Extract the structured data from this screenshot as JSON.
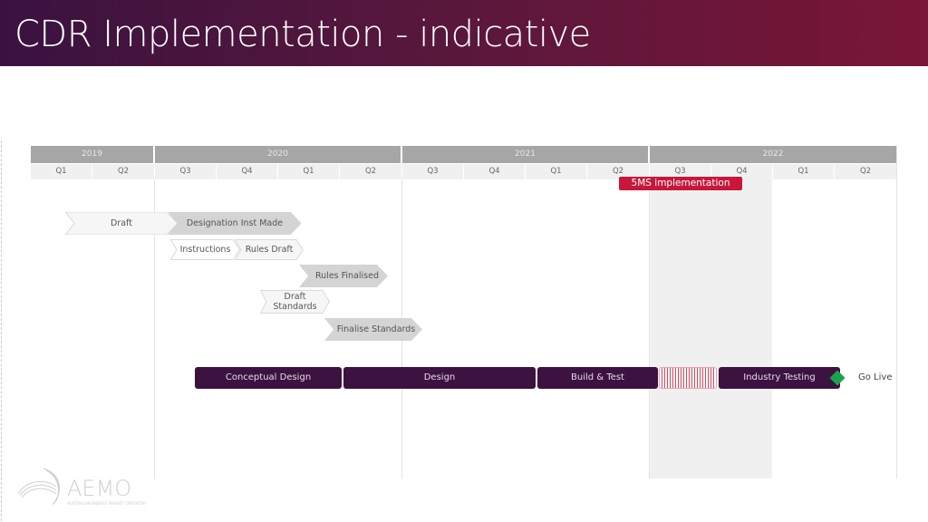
{
  "title": "CDR Implementation - indicative",
  "timeline": {
    "years": [
      "2019",
      "2020",
      "2021",
      "2022"
    ],
    "quarters": [
      "Q1",
      "Q2",
      "Q3",
      "Q4",
      "Q1",
      "Q2",
      "Q3",
      "Q4",
      "Q1",
      "Q2",
      "Q3",
      "Q4",
      "Q1",
      "Q2"
    ]
  },
  "highlight": {
    "label": "5MS implementation",
    "color": "#c8173a"
  },
  "policy_steps": [
    {
      "label": "Draft"
    },
    {
      "label": "Designation Inst Made"
    },
    {
      "label": "Instructions"
    },
    {
      "label": "Rules Draft"
    },
    {
      "label": "Rules Finalised"
    },
    {
      "label": "Draft Standards"
    },
    {
      "label": "Finalise Standards"
    }
  ],
  "phases": [
    {
      "label": "Conceptual Design"
    },
    {
      "label": "Design"
    },
    {
      "label": "Build & Test"
    },
    {
      "label": "Industry Testing"
    }
  ],
  "milestone": {
    "label": "Go Live",
    "color": "#1aa34a"
  },
  "logo": {
    "text": "AEMO",
    "subtitle": "AUSTRALIAN ENERGY MARKET OPERATOR"
  }
}
